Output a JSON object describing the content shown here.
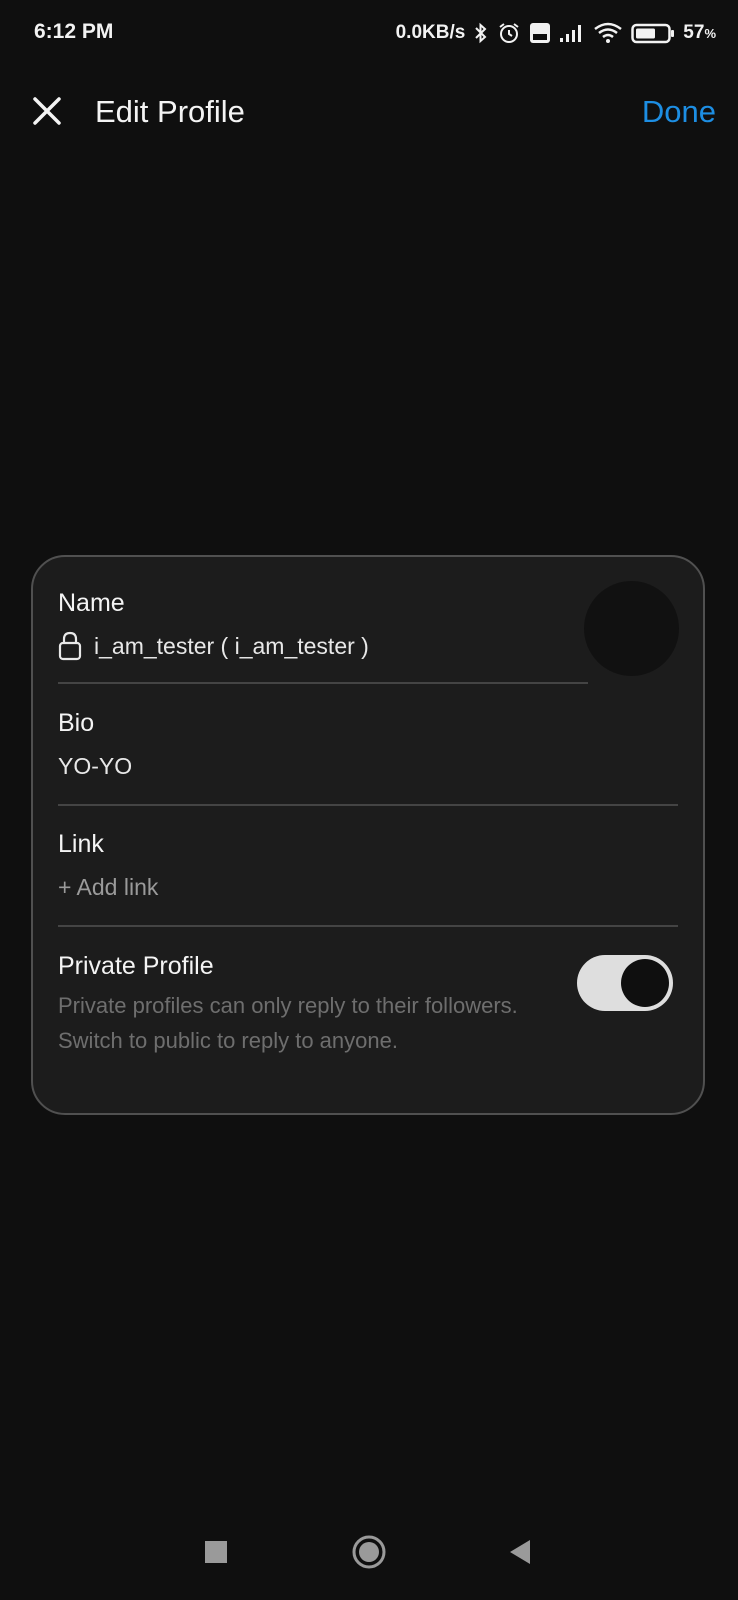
{
  "status_bar": {
    "time": "6:12 PM",
    "net_speed": "0.0KB/s",
    "battery_percent": "57",
    "battery_unit": "%",
    "icons": [
      "bluetooth-icon",
      "alarm-icon",
      "volte-icon",
      "signal-icon",
      "wifi-icon",
      "battery-icon"
    ]
  },
  "header": {
    "title": "Edit Profile",
    "close_icon": "close-icon",
    "done_label": "Done",
    "done_color": "#1d8ee3"
  },
  "profile": {
    "name_label": "Name",
    "name_value": "i_am_tester ( i_am_tester )",
    "bio_label": "Bio",
    "bio_value": "YO-YO",
    "link_label": "Link",
    "link_placeholder": "+ Add link",
    "private_label": "Private Profile",
    "private_description": "Private profiles can only reply to their followers. Switch to public to reply to anyone.",
    "private_enabled": true
  },
  "nav": {
    "icons": [
      "recents-square-icon",
      "home-circle-icon",
      "back-triangle-icon"
    ]
  }
}
